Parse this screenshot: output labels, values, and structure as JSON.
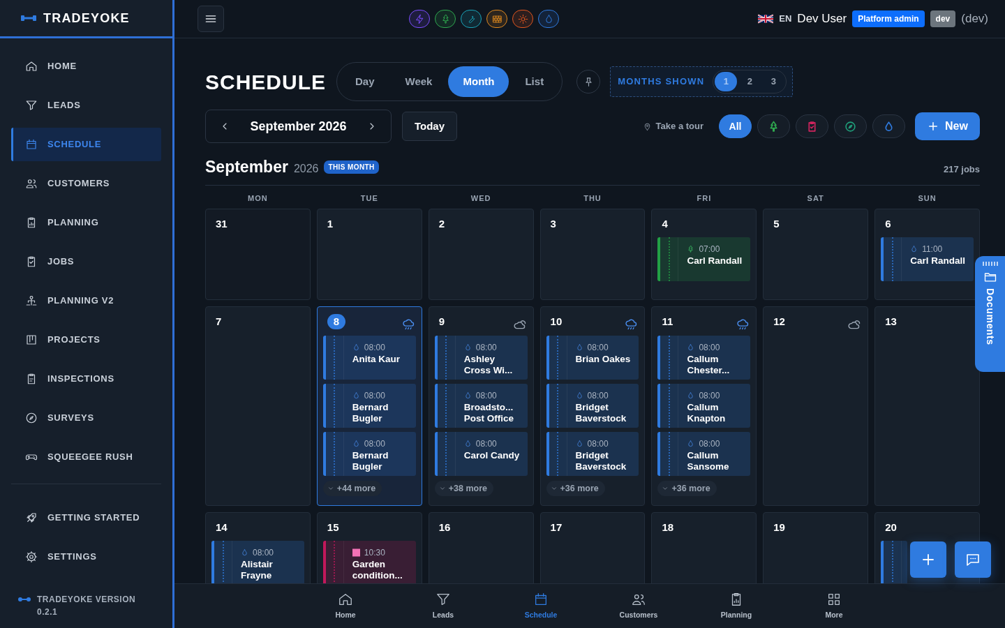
{
  "sidebar": {
    "brand": "TRADEYOKE",
    "items": [
      {
        "label": "HOME",
        "kind": "home",
        "selected": false
      },
      {
        "label": "LEADS",
        "kind": "funnel",
        "selected": false
      },
      {
        "label": "SCHEDULE",
        "kind": "calendar",
        "selected": true
      },
      {
        "label": "CUSTOMERS",
        "kind": "users",
        "selected": false
      },
      {
        "label": "PLANNING",
        "kind": "chart",
        "selected": false
      },
      {
        "label": "JOBS",
        "kind": "clipcheck",
        "selected": false
      },
      {
        "label": "PLANNING V2",
        "kind": "network",
        "selected": false
      },
      {
        "label": "PROJECTS",
        "kind": "kanban",
        "selected": false
      },
      {
        "label": "INSPECTIONS",
        "kind": "clipline",
        "selected": false
      },
      {
        "label": "SURVEYS",
        "kind": "compass",
        "selected": false
      },
      {
        "label": "SQUEEGEE RUSH",
        "kind": "gamepad",
        "selected": false
      }
    ],
    "footer_items": [
      {
        "label": "GETTING STARTED",
        "kind": "rocket",
        "selected": false
      },
      {
        "label": "SETTINGS",
        "kind": "gear",
        "selected": false
      }
    ],
    "version_label": "TRADEYOKE VERSION",
    "version": "0.2.1"
  },
  "topbar": {
    "trades": [
      {
        "kind": "bolt",
        "color": "#7c4dff"
      },
      {
        "kind": "tree",
        "color": "#2fa84f"
      },
      {
        "kind": "wrench",
        "color": "#1aa3b8"
      },
      {
        "kind": "brick",
        "color": "#e08a1e"
      },
      {
        "kind": "sun",
        "color": "#e0561e"
      },
      {
        "kind": "drop",
        "color": "#2f7be0"
      }
    ],
    "language": "EN",
    "user": "Dev User",
    "role": "Platform admin",
    "env": "dev",
    "env_note": "(dev)"
  },
  "header": {
    "title": "SCHEDULE",
    "views": [
      {
        "label": "Day",
        "selected": false
      },
      {
        "label": "Week",
        "selected": false
      },
      {
        "label": "Month",
        "selected": true
      },
      {
        "label": "List",
        "selected": false
      }
    ],
    "months_label": "MONTHS SHOWN",
    "months": [
      {
        "label": "1",
        "selected": true
      },
      {
        "label": "2",
        "selected": false
      },
      {
        "label": "3",
        "selected": false
      }
    ],
    "period": "September 2026",
    "today": "Today",
    "tour": "Take a tour",
    "filters": [
      {
        "kind": "all",
        "label": "All",
        "selected": true
      },
      {
        "kind": "tree",
        "color": "#2fa84f",
        "selected": false
      },
      {
        "kind": "clipcheck",
        "color": "#d0245e",
        "selected": false
      },
      {
        "kind": "compass",
        "color": "#1f9e7a",
        "selected": false
      },
      {
        "kind": "drop",
        "color": "#2f7be0",
        "selected": false
      }
    ],
    "new_label": "New"
  },
  "month": {
    "name": "September",
    "year": "2026",
    "badge": "THIS MONTH",
    "count": "217 jobs"
  },
  "weekdays": [
    "MON",
    "TUE",
    "WED",
    "THU",
    "FRI",
    "SAT",
    "SUN"
  ],
  "weeks": [
    [
      {
        "number": "31",
        "outside": true
      },
      {
        "number": "1"
      },
      {
        "number": "2"
      },
      {
        "number": "3"
      },
      {
        "number": "4",
        "events": [
          {
            "time": "07:00",
            "name": "Carl Randall",
            "kind": "tree",
            "color": "#22a045"
          }
        ]
      },
      {
        "number": "5"
      },
      {
        "number": "6",
        "events": [
          {
            "time": "11:00",
            "name": "Carl Randall",
            "kind": "drop",
            "color": "#2f7be0"
          }
        ]
      }
    ],
    [
      {
        "number": "7"
      },
      {
        "number": "8",
        "today": true,
        "weather": {
          "kind": "rain"
        },
        "events": [
          {
            "time": "08:00",
            "name": "Anita Kaur",
            "kind": "drop",
            "color": "#2f7be0"
          },
          {
            "time": "08:00",
            "name": "Bernard Bugler",
            "kind": "drop",
            "color": "#2f7be0"
          },
          {
            "time": "08:00",
            "name": "Bernard Bugler",
            "kind": "drop",
            "color": "#2f7be0"
          }
        ],
        "more": "+44 more"
      },
      {
        "number": "9",
        "weather": {
          "kind": "cloud"
        },
        "events": [
          {
            "time": "08:00",
            "name": "Ashley Cross Wi...",
            "kind": "drop",
            "color": "#2f7be0"
          },
          {
            "time": "08:00",
            "name": "Broadsto... Post Office",
            "kind": "drop",
            "color": "#2f7be0"
          },
          {
            "time": "08:00",
            "name": "Carol Candy",
            "kind": "drop",
            "color": "#2f7be0"
          }
        ],
        "more": "+38 more"
      },
      {
        "number": "10",
        "weather": {
          "kind": "rain"
        },
        "events": [
          {
            "time": "08:00",
            "name": "Brian Oakes",
            "kind": "drop",
            "color": "#2f7be0"
          },
          {
            "time": "08:00",
            "name": "Bridget Baverstock",
            "kind": "drop",
            "color": "#2f7be0"
          },
          {
            "time": "08:00",
            "name": "Bridget Baverstock",
            "kind": "drop",
            "color": "#2f7be0"
          }
        ],
        "more": "+36 more"
      },
      {
        "number": "11",
        "weather": {
          "kind": "rain"
        },
        "events": [
          {
            "time": "08:00",
            "name": "Callum Chester...",
            "kind": "drop",
            "color": "#2f7be0"
          },
          {
            "time": "08:00",
            "name": "Callum Knapton",
            "kind": "drop",
            "color": "#2f7be0"
          },
          {
            "time": "08:00",
            "name": "Callum Sansome",
            "kind": "drop",
            "color": "#2f7be0"
          }
        ],
        "more": "+36 more"
      },
      {
        "number": "12",
        "weather": {
          "kind": "cloud"
        }
      },
      {
        "number": "13"
      }
    ],
    [
      {
        "number": "14",
        "events": [
          {
            "time": "08:00",
            "name": "Alistair Frayne",
            "kind": "drop",
            "color": "#2f7be0"
          }
        ]
      },
      {
        "number": "15",
        "events": [
          {
            "time": "10:30",
            "name": "Garden condition...",
            "kind": "square",
            "color": "#c2185b"
          }
        ]
      },
      {
        "number": "16"
      },
      {
        "number": "17"
      },
      {
        "number": "18"
      },
      {
        "number": "19"
      },
      {
        "number": "20",
        "events": [
          {
            "color": "#2f7be0"
          }
        ]
      }
    ]
  ],
  "documents_tab": "Documents",
  "bottom_nav": [
    {
      "label": "Home",
      "kind": "home",
      "selected": false
    },
    {
      "label": "Leads",
      "kind": "funnel",
      "selected": false
    },
    {
      "label": "Schedule",
      "kind": "calendar",
      "selected": true
    },
    {
      "label": "Customers",
      "kind": "users",
      "selected": false
    },
    {
      "label": "Planning",
      "kind": "chart",
      "selected": false
    },
    {
      "label": "More",
      "kind": "grid",
      "selected": false
    }
  ]
}
